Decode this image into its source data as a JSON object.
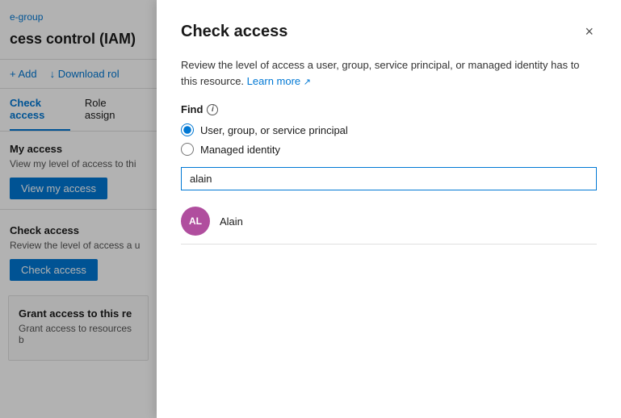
{
  "left_panel": {
    "breadcrumb_link": "e-group",
    "title": "cess control (IAM)",
    "toolbar": {
      "add_label": "+ Add",
      "download_label": "↓ Download rol"
    },
    "tabs": [
      {
        "label": "Check access",
        "active": true
      },
      {
        "label": "Role assign",
        "active": false
      }
    ],
    "my_access_section": {
      "title": "My access",
      "description": "View my level of access to thi",
      "button_label": "View my access"
    },
    "check_access_section": {
      "title": "Check access",
      "description": "Review the level of access a u",
      "button_label": "Check access"
    },
    "grant_section": {
      "title": "Grant access to this re",
      "description": "Grant access to resources b"
    }
  },
  "modal": {
    "title": "Check access",
    "close_icon": "×",
    "description": "Review the level of access a user, group, service principal, or managed identity has to this resource.",
    "learn_more_label": "Learn more",
    "find_label": "Find",
    "radio_options": [
      {
        "label": "User, group, or service principal",
        "value": "user",
        "checked": true
      },
      {
        "label": "Managed identity",
        "value": "managed",
        "checked": false
      }
    ],
    "search_input": {
      "value": "alain",
      "placeholder": ""
    },
    "result": {
      "initials": "AL",
      "name": "Alain"
    }
  }
}
